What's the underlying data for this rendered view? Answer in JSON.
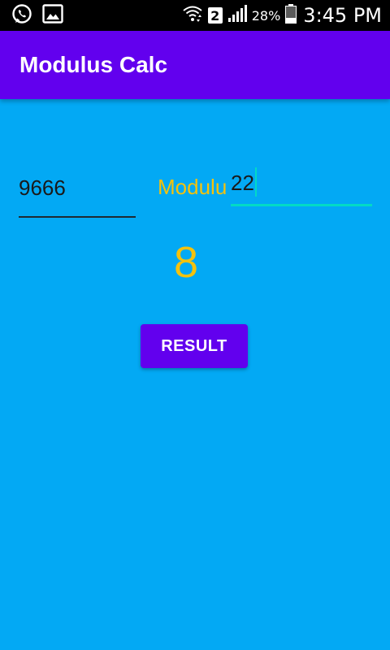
{
  "status_bar": {
    "icons_left": [
      "whatsapp-icon",
      "image-icon"
    ],
    "icons_right": [
      "wifi-icon",
      "sim-2-icon",
      "signal-icon",
      "battery-icon"
    ],
    "sim_label": "2",
    "battery_percent": "28%",
    "time": "3:45 PM"
  },
  "app_bar": {
    "title": "Modulus Calc",
    "background": "#6200EE"
  },
  "form": {
    "dividend_value": "9666",
    "operator_label": "Modulu",
    "divisor_value": "22"
  },
  "result": {
    "value": "8"
  },
  "button": {
    "label": "RESULT"
  },
  "colors": {
    "background": "#03A9F4",
    "accent": "#F4C20D",
    "focus_underline": "#03DAC5",
    "primary": "#6200EE"
  }
}
